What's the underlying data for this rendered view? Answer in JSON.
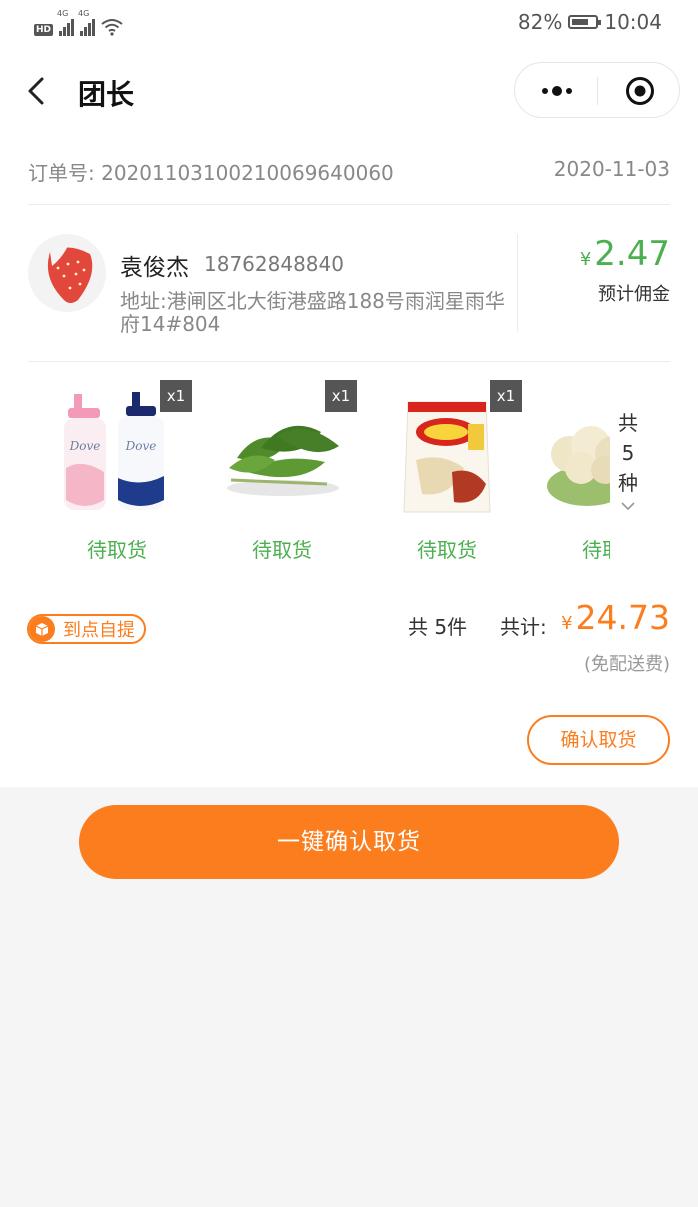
{
  "status_bar": {
    "hd": "HD",
    "network1": "4G",
    "network2": "4G",
    "battery": "82%",
    "time": "10:04"
  },
  "nav": {
    "title": "团长"
  },
  "order": {
    "label": "订单号:",
    "number": "20201103100210069640060",
    "date": "2020-11-03"
  },
  "customer": {
    "name": "袁俊杰",
    "phone": "18762848840",
    "address": "地址:港闸区北大街港盛路188号雨润星雨华府14#804"
  },
  "commission": {
    "currency": "¥",
    "amount": "2.47",
    "label": "预计佣金"
  },
  "products": [
    {
      "icon": "shampoo-bottles",
      "qty": "x1",
      "status": "待取货"
    },
    {
      "icon": "spinach",
      "qty": "x1",
      "status": "待取货"
    },
    {
      "icon": "snack-bag",
      "qty": "x1",
      "status": "待取货"
    },
    {
      "icon": "cauliflower",
      "status": "待取货"
    }
  ],
  "kind_count": [
    "共",
    "5",
    "种"
  ],
  "pickup": {
    "label": "到点自提"
  },
  "summary": {
    "count": "共 5件",
    "total_label": "共计:",
    "currency": "¥",
    "total": "24.73",
    "freight": "(免配送费)"
  },
  "buttons": {
    "confirm": "确认取货",
    "confirm_all": "一键确认取货"
  },
  "colors": {
    "accent": "#fb7d1e",
    "green": "#4caf50"
  }
}
